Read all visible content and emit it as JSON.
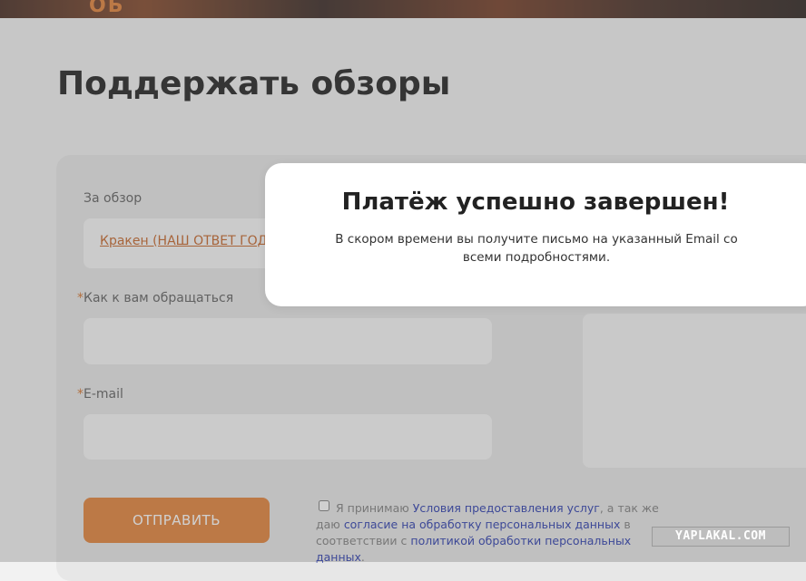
{
  "banner": {
    "glyph": "ОБ"
  },
  "page": {
    "title": "Поддержать обзоры"
  },
  "form": {
    "review_label": "За обзор",
    "review_value": "Кракен (НАШ ОТВЕТ ГОД",
    "required_mark": "*",
    "name_label": "Как к вам обращаться",
    "name_value": "",
    "email_label": "E-mail",
    "email_value": "",
    "submit_label": "ОТПРАВИТЬ",
    "consent": {
      "text_1": "Я принимаю ",
      "link_terms": "Условия предоставления услуг",
      "text_2": ", а так же даю ",
      "link_consent": "согласие на обработку персональных данных",
      "text_3": " в соответствии с ",
      "link_policy": "политикой обработки персональных данных",
      "text_4": "."
    }
  },
  "modal": {
    "title": "Платёж успешно завершен!",
    "message": "В скором времени вы получите письмо на указанный Email со всеми подробностями."
  },
  "watermark": {
    "text": "YAPLAKAL.COM"
  },
  "colors": {
    "accent": "#e07a2c",
    "link": "#1d2fa8",
    "overlay": "rgba(120,120,120,0.35)"
  }
}
